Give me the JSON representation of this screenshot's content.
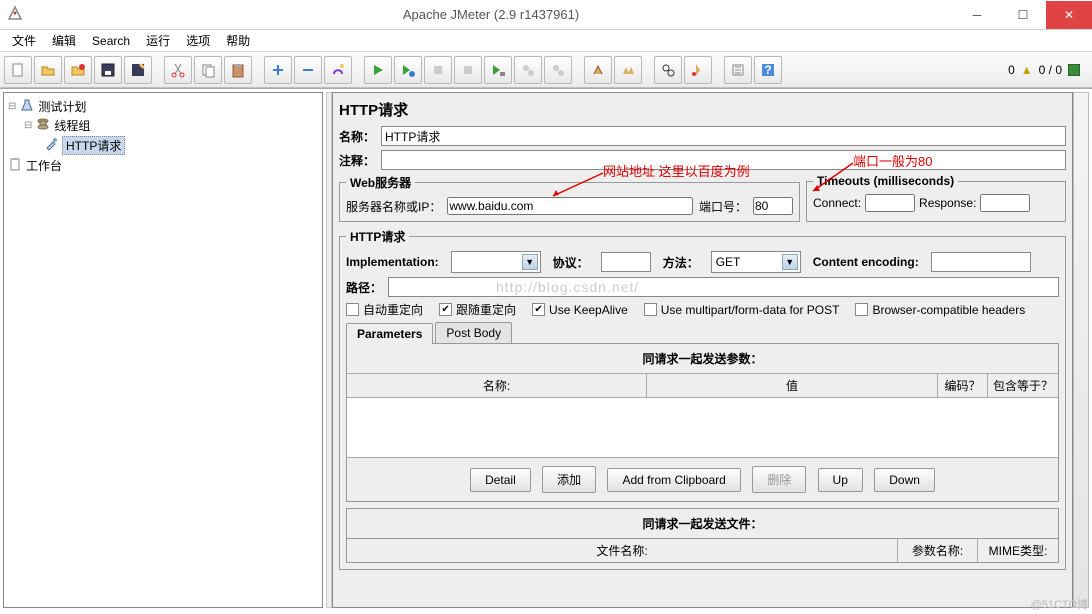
{
  "window": {
    "title": "Apache JMeter (2.9 r1437961)"
  },
  "menu": {
    "file": "文件",
    "edit": "编辑",
    "search": "Search",
    "run": "运行",
    "options": "选项",
    "help": "帮助"
  },
  "status": {
    "left": "0",
    "right": "0 / 0"
  },
  "tree": {
    "plan": "测试计划",
    "threadGroup": "线程组",
    "httpRequest": "HTTP请求",
    "workbench": "工作台"
  },
  "panel": {
    "title": "HTTP请求",
    "nameLabel": "名称：",
    "nameValue": "HTTP请求",
    "commentLabel": "注释：",
    "commentValue": "",
    "webServer": {
      "legend": "Web服务器",
      "hostLabel": "服务器名称或IP：",
      "hostValue": "www.baidu.com",
      "portLabel": "端口号：",
      "portValue": "80"
    },
    "timeouts": {
      "legend": "Timeouts (milliseconds)",
      "connectLabel": "Connect:",
      "connectValue": "",
      "responseLabel": "Response:",
      "responseValue": ""
    },
    "http": {
      "legend": "HTTP请求",
      "implLabel": "Implementation:",
      "implValue": "",
      "protoLabel": "协议：",
      "protoValue": "",
      "methodLabel": "方法：",
      "methodValue": "GET",
      "encodingLabel": "Content encoding:",
      "encodingValue": "",
      "pathLabel": "路径：",
      "pathValue": ""
    },
    "checks": {
      "autoRedirect": "自动重定向",
      "followRedirect": "跟随重定向",
      "keepalive": "Use KeepAlive",
      "multipart": "Use multipart/form-data for POST",
      "browserHeaders": "Browser-compatible headers"
    },
    "tabs": {
      "params": "Parameters",
      "postBody": "Post Body"
    },
    "params": {
      "sendWith": "同请求一起发送参数：",
      "colName": "名称:",
      "colValue": "值",
      "colEncode": "编码？",
      "colInclude": "包含等于？"
    },
    "btns": {
      "detail": "Detail",
      "add": "添加",
      "clip": "Add from Clipboard",
      "del": "删除",
      "up": "Up",
      "down": "Down"
    },
    "files": {
      "sendWith": "同请求一起发送文件：",
      "colFile": "文件名称:",
      "colParam": "参数名称:",
      "colMime": "MIME类型:"
    }
  },
  "annotations": {
    "host": "网站地址 这里以百度为例",
    "port": "端口一般为80"
  },
  "watermark": "http://blog.csdn.net/",
  "footer": "@51CTO博"
}
